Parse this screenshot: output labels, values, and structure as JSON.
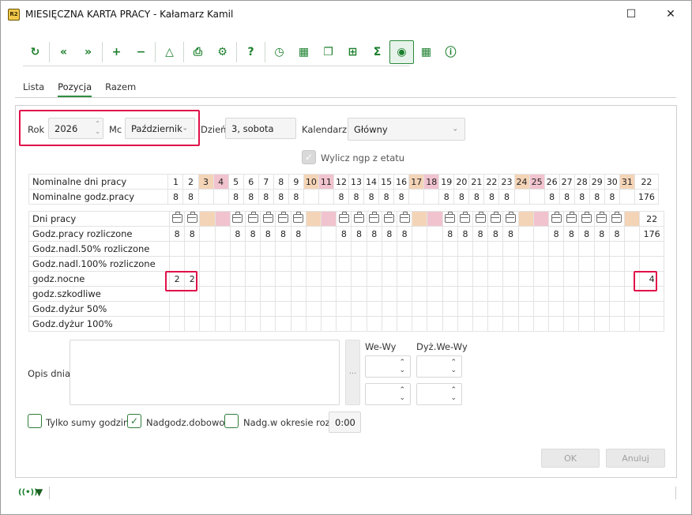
{
  "window": {
    "app_icon_text": "R2",
    "title": "MIESIĘCZNA KARTA PRACY - Kałamarz Kamil",
    "maximize_glyph": "☐",
    "close_glyph": "✕"
  },
  "toolbar": {
    "buttons": [
      {
        "name": "refresh-icon",
        "glyph": "↻"
      },
      {
        "name": "prev-month-icon",
        "glyph": "«"
      },
      {
        "name": "next-month-icon",
        "glyph": "»"
      },
      {
        "name": "add-icon",
        "glyph": "+"
      },
      {
        "name": "remove-icon",
        "glyph": "−"
      },
      {
        "name": "triangle-icon",
        "glyph": "△"
      },
      {
        "name": "print-icon",
        "glyph": "⎙"
      },
      {
        "name": "settings-icon",
        "glyph": "⚙"
      },
      {
        "name": "help-icon",
        "glyph": "?"
      },
      {
        "name": "clock-icon",
        "glyph": "◷"
      },
      {
        "name": "calendar-remove-icon",
        "glyph": "▦"
      },
      {
        "name": "copy-icon",
        "glyph": "❐"
      },
      {
        "name": "add-box-icon",
        "glyph": "⊞"
      },
      {
        "name": "sum-icon",
        "glyph": "Σ"
      },
      {
        "name": "eye-icon",
        "glyph": "◉",
        "active": true
      },
      {
        "name": "calendar-clock-icon",
        "glyph": "▦"
      },
      {
        "name": "info-icon",
        "glyph": "ⓘ"
      }
    ]
  },
  "tabs": [
    "Lista",
    "Pozycja",
    "Razem"
  ],
  "active_tab": "Pozycja",
  "form": {
    "rok_label": "Rok",
    "rok_value": "2026",
    "mc_label": "Mc",
    "mc_value": "Październik",
    "dzien_label": "Dzień",
    "dzien_value": "3, sobota",
    "kalendarz_label": "Kalendarz",
    "kalendarz_value": "Główny",
    "wylicz_label": "Wylicz ngp z etatu",
    "wylicz_checked": true
  },
  "nominal": {
    "rows": [
      "Nominalne dni pracy",
      "Nominalne godz.pracy"
    ],
    "days": [
      "1",
      "2",
      "3",
      "4",
      "5",
      "6",
      "7",
      "8",
      "9",
      "10",
      "11",
      "12",
      "13",
      "14",
      "15",
      "16",
      "17",
      "18",
      "19",
      "20",
      "21",
      "22",
      "23",
      "24",
      "25",
      "26",
      "27",
      "28",
      "29",
      "30",
      "31"
    ],
    "day_types": [
      "w",
      "w",
      "s",
      "h",
      "w",
      "w",
      "w",
      "w",
      "w",
      "s",
      "h",
      "w",
      "w",
      "w",
      "w",
      "w",
      "s",
      "h",
      "w",
      "w",
      "w",
      "w",
      "w",
      "s",
      "h",
      "w",
      "w",
      "w",
      "w",
      "w",
      "s"
    ],
    "hours": [
      "8",
      "8",
      "",
      "",
      "8",
      "8",
      "8",
      "8",
      "8",
      "",
      "",
      "8",
      "8",
      "8",
      "8",
      "8",
      "",
      "",
      "8",
      "8",
      "8",
      "8",
      "8",
      "",
      "",
      "8",
      "8",
      "8",
      "8",
      "8",
      ""
    ],
    "total_days": "22",
    "total_hours": "176"
  },
  "work": {
    "rows": [
      {
        "label": "Dni pracy",
        "values": [
          "bag",
          "bag",
          "",
          "",
          "bag",
          "bag",
          "bag",
          "bag",
          "bag",
          "",
          "",
          "bag",
          "bag",
          "bag",
          "bag",
          "bag",
          "",
          "",
          "bag",
          "bag",
          "bag",
          "bag",
          "bag",
          "",
          "",
          "bag",
          "bag",
          "bag",
          "bag",
          "bag",
          ""
        ],
        "total": "22",
        "shaded": true
      },
      {
        "label": "Godz.pracy rozliczone",
        "values": [
          "8",
          "8",
          "",
          "",
          "8",
          "8",
          "8",
          "8",
          "8",
          "",
          "",
          "8",
          "8",
          "8",
          "8",
          "8",
          "",
          "",
          "8",
          "8",
          "8",
          "8",
          "8",
          "",
          "",
          "8",
          "8",
          "8",
          "8",
          "8",
          ""
        ],
        "total": "176"
      },
      {
        "label": "Godz.nadl.50% rozliczone",
        "values": [],
        "total": ""
      },
      {
        "label": "Godz.nadl.100% rozliczone",
        "values": [],
        "total": ""
      },
      {
        "label": "godz.nocne",
        "values": [
          "2",
          "2"
        ],
        "total": "4"
      },
      {
        "label": "godz.szkodliwe",
        "values": [],
        "total": ""
      },
      {
        "label": "Godz.dyżur 50%",
        "values": [],
        "total": ""
      },
      {
        "label": "Godz.dyżur 100%",
        "values": [],
        "total": ""
      }
    ]
  },
  "opis": {
    "label": "Opis dnia",
    "ellipsis": "...",
    "we_wy_label": "We-Wy",
    "dyz_we_wy_label": "Dyż.We-Wy"
  },
  "options": {
    "tylko_sumy": "Tylko sumy godzin",
    "tylko_sumy_checked": false,
    "nadgodz_dobowo": "Nadgodz.dobowo",
    "nadgodz_dobowo_checked": true,
    "nadg_okres": "Nadg.w okresie rozl.",
    "nadg_okres_checked": false,
    "nadg_okres_value": "0:00"
  },
  "buttons": {
    "ok": "OK",
    "anuluj": "Anuluj"
  },
  "colors": {
    "accent": "#1b7f2c",
    "weekend_saturday": "#f4d4b6",
    "weekend_sunday": "#f1c3cf",
    "highlight": "#e0104a"
  }
}
